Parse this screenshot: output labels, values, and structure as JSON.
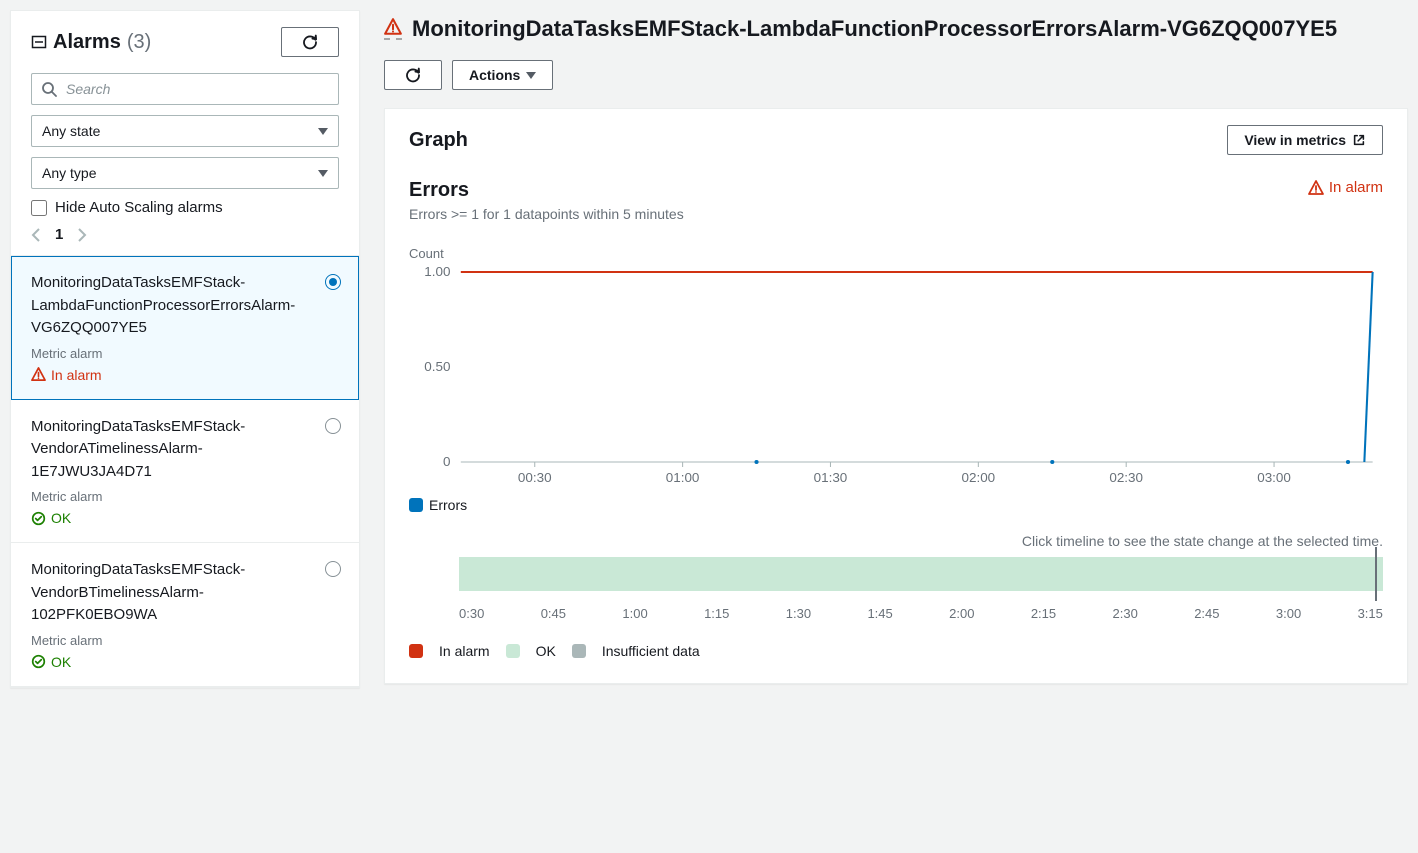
{
  "sidebar": {
    "title": "Alarms",
    "count": "(3)",
    "search_placeholder": "Search",
    "state_filter": "Any state",
    "type_filter": "Any type",
    "hide_autoscaling_label": "Hide Auto Scaling alarms",
    "page": "1"
  },
  "alarms": [
    {
      "name": "MonitoringDataTasksEMFStack-LambdaFunctionProcessorErrorsAlarm-VG6ZQQ007YE5",
      "type": "Metric alarm",
      "status": "In alarm",
      "status_kind": "alarm",
      "selected": true
    },
    {
      "name": "MonitoringDataTasksEMFStack-VendorATimelinessAlarm-1E7JWU3JA4D71",
      "type": "Metric alarm",
      "status": "OK",
      "status_kind": "ok",
      "selected": false
    },
    {
      "name": "MonitoringDataTasksEMFStack-VendorBTimelinessAlarm-102PFK0EBO9WA",
      "type": "Metric alarm",
      "status": "OK",
      "status_kind": "ok",
      "selected": false
    }
  ],
  "main": {
    "title": "MonitoringDataTasksEMFStack-LambdaFunctionProcessorErrorsAlarm-VG6ZQQ007YE5",
    "actions_label": "Actions",
    "panel_title": "Graph",
    "view_metrics_label": "View in metrics",
    "status_badge": "In alarm",
    "graph_title": "Errors",
    "graph_subtitle": "Errors >= 1 for 1 datapoints within 5 minutes",
    "y_label": "Count",
    "legend_series": "Errors",
    "timeline_hint": "Click timeline to see the state change at the selected time.",
    "state_legend": {
      "alarm": "In alarm",
      "ok": "OK",
      "insufficient": "Insufficient data"
    }
  },
  "chart_data": {
    "type": "line",
    "title": "Errors",
    "xlabel": "",
    "ylabel": "Count",
    "ylim": [
      0,
      1.0
    ],
    "y_ticks": [
      0,
      0.5,
      1.0
    ],
    "x_ticks": [
      "00:30",
      "01:00",
      "01:30",
      "02:00",
      "02:30",
      "03:00"
    ],
    "threshold": 1.0,
    "series": [
      {
        "name": "Errors",
        "color": "#0073bb",
        "x": [
          "01:15",
          "02:15",
          "03:15",
          "03:16"
        ],
        "y": [
          0,
          0,
          0,
          1.0
        ]
      }
    ],
    "timeline_ticks": [
      "0:30",
      "0:45",
      "1:00",
      "1:15",
      "1:30",
      "1:45",
      "2:00",
      "2:15",
      "2:30",
      "2:45",
      "3:00",
      "3:15"
    ]
  },
  "colors": {
    "alarm": "#d13212",
    "ok": "#1d8102",
    "series": "#0073bb",
    "ok_fill": "#c9e8d6",
    "insufficient": "#aab7b8"
  }
}
